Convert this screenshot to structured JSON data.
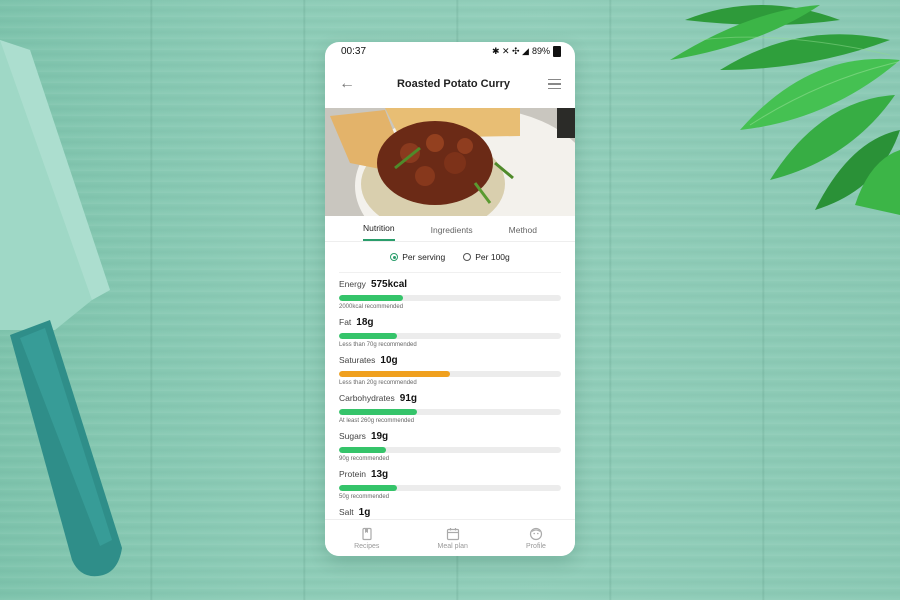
{
  "status_bar": {
    "time": "00:37",
    "icons": "✱ ✕ ✣ ◢",
    "battery": "89%"
  },
  "app_bar": {
    "title": "Roasted Potato Curry",
    "back_icon": "arrow-left-icon",
    "menu_icon": "hamburger-menu-icon"
  },
  "tabs": [
    {
      "label": "Nutrition",
      "active": true
    },
    {
      "label": "Ingredients",
      "active": false
    },
    {
      "label": "Method",
      "active": false
    }
  ],
  "basis": {
    "options": [
      {
        "label": "Per serving",
        "selected": true
      },
      {
        "label": "Per 100g",
        "selected": false
      }
    ]
  },
  "nutrients": [
    {
      "label": "Energy",
      "value": "575kcal",
      "note": "2000kcal recommended",
      "fraction": 0.29,
      "color": "#35c46a"
    },
    {
      "label": "Fat",
      "value": "18g",
      "note": "Less than 70g recommended",
      "fraction": 0.26,
      "color": "#35c46a"
    },
    {
      "label": "Saturates",
      "value": "10g",
      "note": "Less than 20g recommended",
      "fraction": 0.5,
      "color": "#f0a01e"
    },
    {
      "label": "Carbohydrates",
      "value": "91g",
      "note": "At least 260g recommended",
      "fraction": 0.35,
      "color": "#35c46a"
    },
    {
      "label": "Sugars",
      "value": "19g",
      "note": "90g recommended",
      "fraction": 0.21,
      "color": "#35c46a"
    },
    {
      "label": "Protein",
      "value": "13g",
      "note": "50g recommended",
      "fraction": 0.26,
      "color": "#35c46a"
    },
    {
      "label": "Salt",
      "value": "1g",
      "note": "",
      "fraction": 0,
      "color": "#35c46a"
    }
  ],
  "bottom_nav": [
    {
      "label": "Recipes",
      "icon": "book-icon"
    },
    {
      "label": "Meal plan",
      "icon": "calendar-icon"
    },
    {
      "label": "Profile",
      "icon": "profile-icon"
    }
  ],
  "colors": {
    "accent": "#2a9d6b",
    "bar_green": "#35c46a",
    "bar_amber": "#f0a01e",
    "background": "#8fcdb8"
  }
}
